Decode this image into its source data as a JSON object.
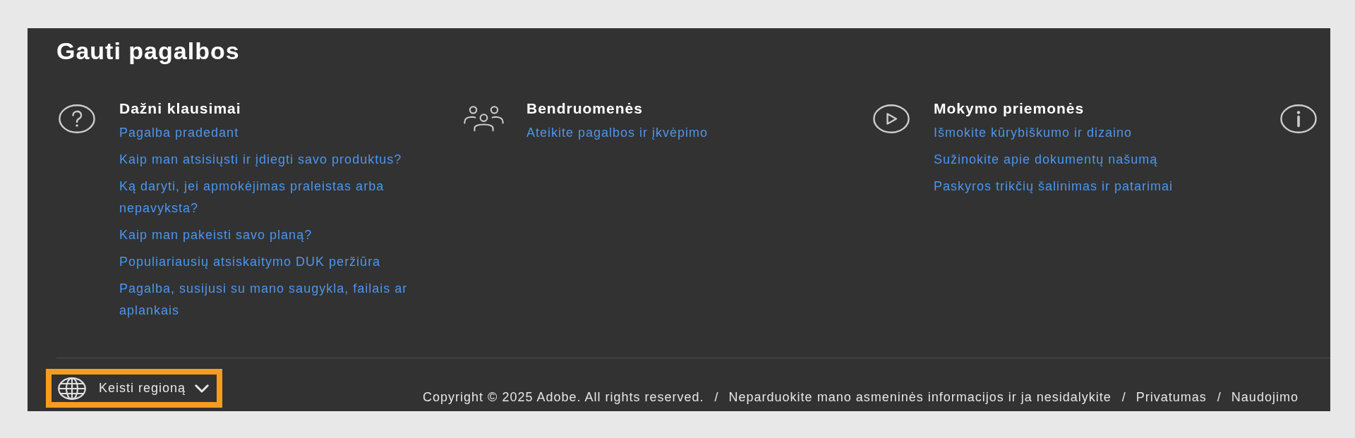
{
  "panel": {
    "heading": "Gauti pagalbos",
    "sections": [
      {
        "kind": "question",
        "title": "Dažni klausimai",
        "links": [
          "Pagalba pradedant",
          "Kaip man atsisiųsti ir įdiegti savo produktus?",
          "Ką daryti, jei apmokėjimas praleistas arba nepavyksta?",
          "Kaip man pakeisti savo planą?",
          "Populiariausių atsiskaitymo DUK peržiūra",
          "Pagalba, susijusi su mano saugykla, failais ar aplankais"
        ]
      },
      {
        "kind": "people",
        "title": "Bendruomenės",
        "links": [
          "Ateikite pagalbos ir įkvėpimo"
        ]
      },
      {
        "kind": "play",
        "title": "Mokymo priemonės",
        "links": [
          "Išmokite kūrybiškumo ir dizaino",
          "Sužinokite apie dokumentų našumą",
          "Paskyros trikčių šalinimas ir patarimai"
        ]
      },
      {
        "kind": "info"
      }
    ]
  },
  "footer": {
    "region_button": {
      "label": "Keisti regioną",
      "highlighted": true
    },
    "legal": [
      {
        "kind": "text",
        "text": "Copyright © 2025 Adobe. All rights reserved."
      },
      {
        "kind": "separator",
        "text": "/"
      },
      {
        "kind": "link",
        "text": "Neparduokite mano asmeninės informacijos ir ja nesidalykite"
      },
      {
        "kind": "separator",
        "text": "/"
      },
      {
        "kind": "link",
        "text": "Privatumas"
      },
      {
        "kind": "separator",
        "text": "/"
      },
      {
        "kind": "link",
        "text": "Naudojimo"
      }
    ]
  }
}
